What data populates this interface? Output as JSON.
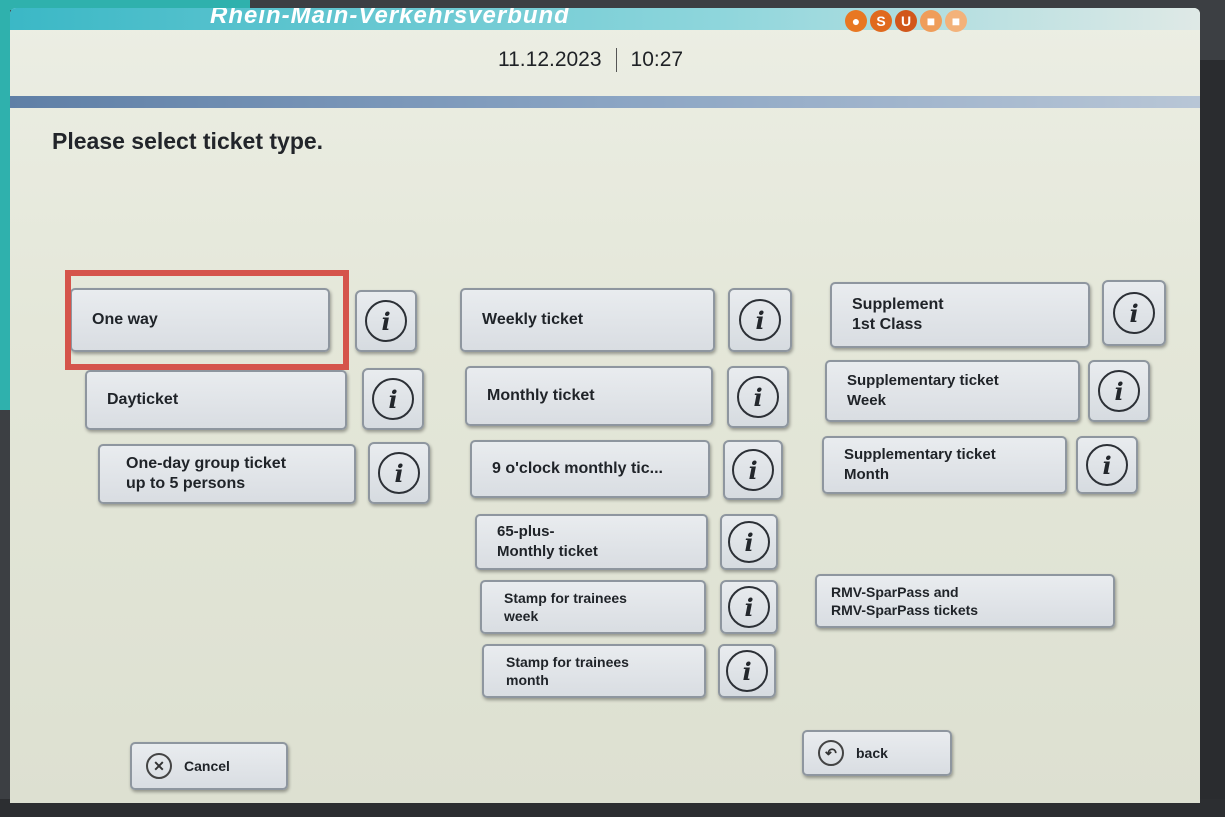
{
  "header": {
    "brand": "Rhein-Main-Verkehrsverbund",
    "date": "11.12.2023",
    "time": "10:27",
    "logo_icons": [
      "train-icon",
      "s-bahn-icon",
      "u-bahn-icon",
      "bus-icon",
      "tram-icon"
    ],
    "logo_labels": [
      "",
      "S",
      "U",
      "",
      ""
    ]
  },
  "prompt": "Please select ticket type.",
  "tickets": {
    "col1": [
      "One way",
      "Dayticket",
      "One-day group ticket\nup to 5 persons"
    ],
    "col2": [
      "Weekly ticket",
      "Monthly ticket",
      "9 o'clock monthly tic...",
      "65-plus-\nMonthly ticket",
      "Stamp for trainees\nweek",
      "Stamp for trainees\nmonth"
    ],
    "col3": [
      "Supplement\n1st Class",
      "Supplementary ticket\nWeek",
      "Supplementary ticket\nMonth",
      "RMV-SparPass and\nRMV-SparPass tickets"
    ]
  },
  "info_label": "i",
  "footer": {
    "cancel_label": "Cancel",
    "back_label": "back"
  },
  "colors": {
    "accent_teal": "#2fb1ad",
    "highlight": "#d5544b",
    "button_border": "#8e969f"
  }
}
